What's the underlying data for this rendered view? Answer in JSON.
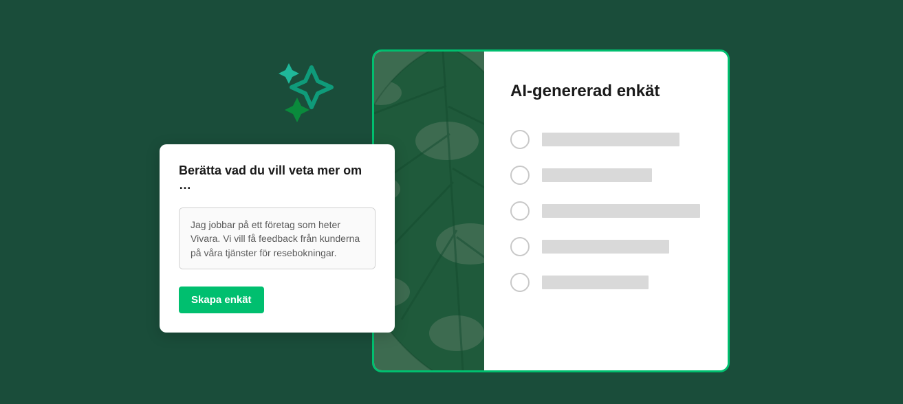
{
  "sparkle_icon": "sparkle-cluster-icon",
  "prompt": {
    "title": "Berätta vad du vill veta mer om …",
    "textarea_value": "Jag jobbar på ett företag som heter Vivara. Vi vill få feedback från kunderna på våra tjänster för resebokningar.",
    "button_label": "Skapa enkät"
  },
  "preview": {
    "title": "AI-genererad enkät",
    "option_bar_widths": [
      200,
      160,
      230,
      185,
      155
    ]
  },
  "colors": {
    "page_bg": "#1a4d3a",
    "accent": "#00bf6f",
    "card_bg": "#ffffff",
    "placeholder": "#d9d9d9"
  }
}
